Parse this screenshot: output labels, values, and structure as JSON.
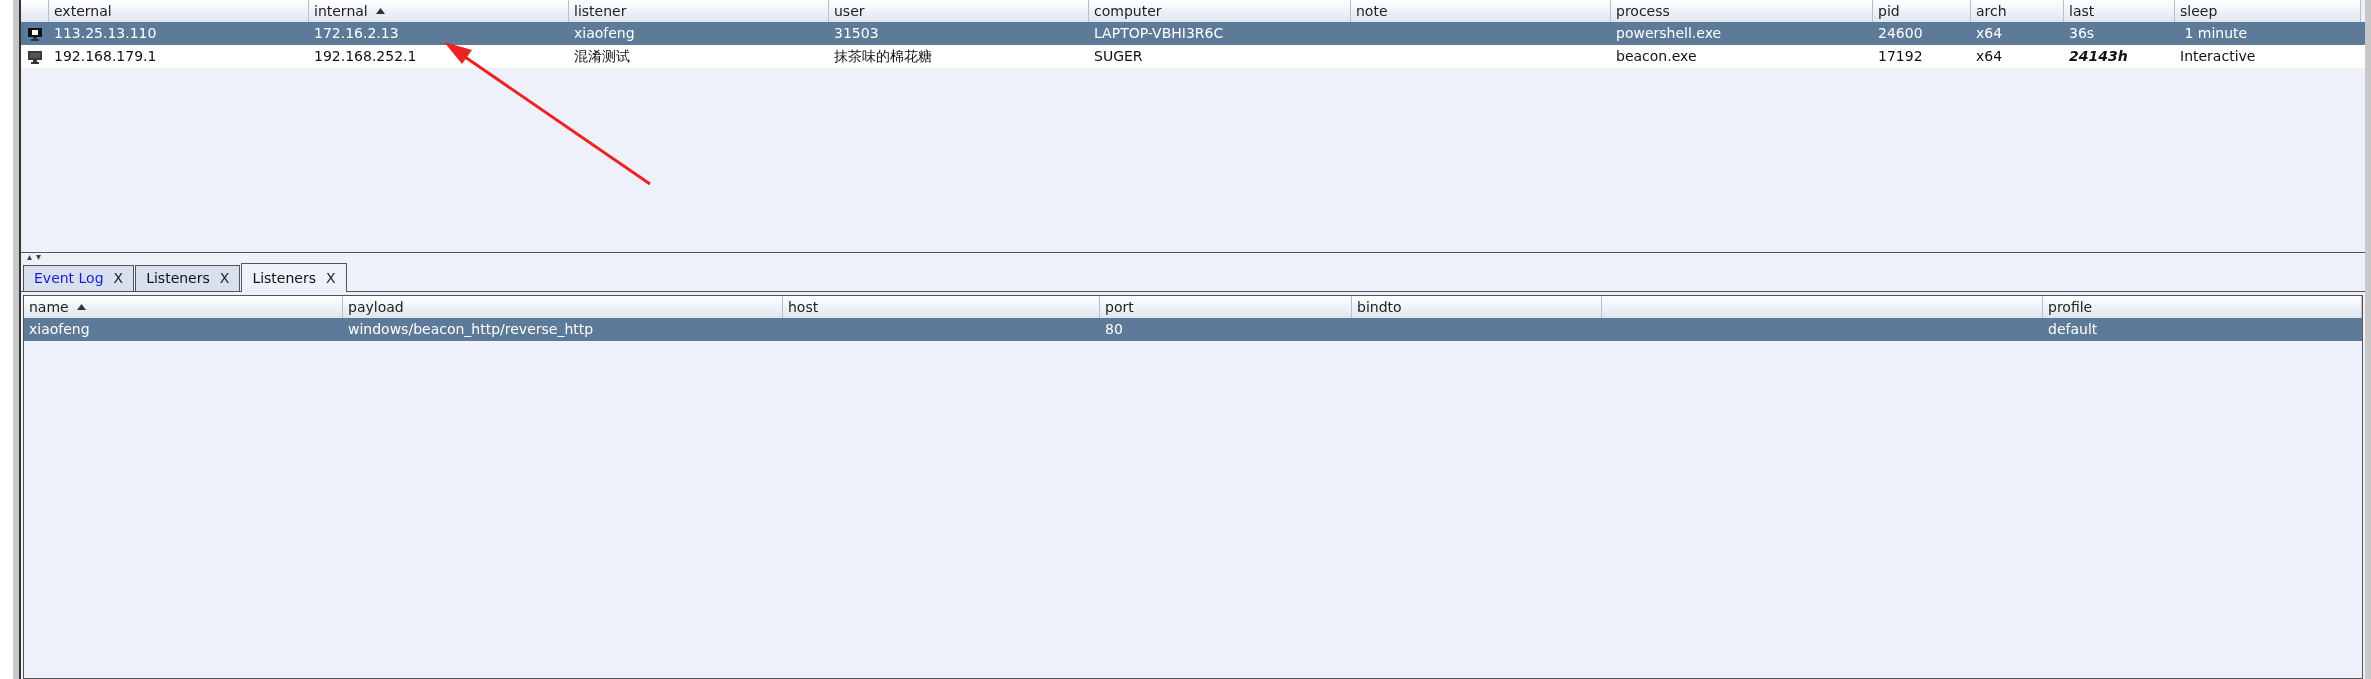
{
  "sessions_table": {
    "columns": [
      {
        "label": "external",
        "sorted": false
      },
      {
        "label": "internal",
        "sorted": true
      },
      {
        "label": "listener",
        "sorted": false
      },
      {
        "label": "user",
        "sorted": false
      },
      {
        "label": "computer",
        "sorted": false
      },
      {
        "label": "note",
        "sorted": false
      },
      {
        "label": "process",
        "sorted": false
      },
      {
        "label": "pid",
        "sorted": false
      },
      {
        "label": "arch",
        "sorted": false
      },
      {
        "label": "last",
        "sorted": false
      },
      {
        "label": "sleep",
        "sorted": false
      }
    ],
    "rows": [
      {
        "selected": true,
        "stale": false,
        "cells": [
          "113.25.13.110",
          "172.16.2.13",
          "xiaofeng",
          "31503",
          "LAPTOP-VBHI3R6C",
          "",
          "powershell.exe",
          "24600",
          "x64",
          "36s",
          " 1 minute"
        ]
      },
      {
        "selected": false,
        "stale": true,
        "cells": [
          "192.168.179.1",
          "192.168.252.1",
          "混淆测试",
          "抹茶味的棉花糖",
          "SUGER",
          "",
          "beacon.exe",
          "17192",
          "x64",
          "24143h",
          "Interactive"
        ]
      }
    ]
  },
  "tabs": [
    {
      "label": "Event Log",
      "close": "X",
      "selected": false,
      "highlighted": true
    },
    {
      "label": "Listeners",
      "close": "X",
      "selected": false,
      "highlighted": false
    },
    {
      "label": "Listeners",
      "close": "X",
      "selected": true,
      "highlighted": false
    }
  ],
  "listeners_table": {
    "columns": [
      {
        "label": "name",
        "sorted": true
      },
      {
        "label": "payload",
        "sorted": false
      },
      {
        "label": "host",
        "sorted": false
      },
      {
        "label": "port",
        "sorted": false
      },
      {
        "label": "bindto",
        "sorted": false
      },
      {
        "sorted": false
      },
      {
        "label": "profile",
        "sorted": false
      }
    ],
    "rows": [
      {
        "selected": true,
        "cells": [
          "xiaofeng",
          "windows/beacon_http/reverse_http",
          "",
          "80",
          "",
          "",
          "default"
        ]
      }
    ]
  }
}
